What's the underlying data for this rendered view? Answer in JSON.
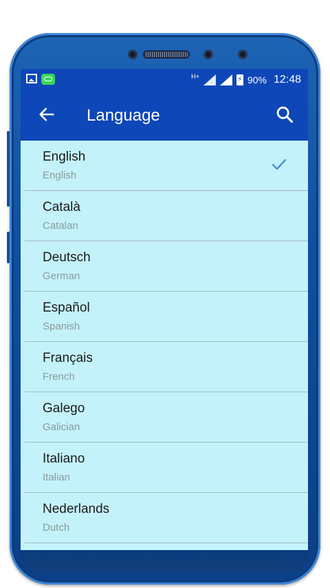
{
  "status_bar": {
    "network_tag": "H+",
    "battery": "90%",
    "time": "12:48"
  },
  "app_bar": {
    "title": "Language"
  },
  "languages": [
    {
      "name": "English",
      "subtitle": "English",
      "selected": true
    },
    {
      "name": "Català",
      "subtitle": "Catalan",
      "selected": false
    },
    {
      "name": "Deutsch",
      "subtitle": "German",
      "selected": false
    },
    {
      "name": "Español",
      "subtitle": "Spanish",
      "selected": false
    },
    {
      "name": "Français",
      "subtitle": "French",
      "selected": false
    },
    {
      "name": "Galego",
      "subtitle": "Galician",
      "selected": false
    },
    {
      "name": "Italiano",
      "subtitle": "Italian",
      "selected": false
    },
    {
      "name": "Nederlands",
      "subtitle": "Dutch",
      "selected": false
    }
  ],
  "colors": {
    "appbar": "#0d47b8",
    "list_bg": "#c4f2fa",
    "check": "#4a8fd8"
  },
  "icons": {
    "back": "arrow-left-icon",
    "search": "search-icon",
    "check": "check-icon"
  }
}
